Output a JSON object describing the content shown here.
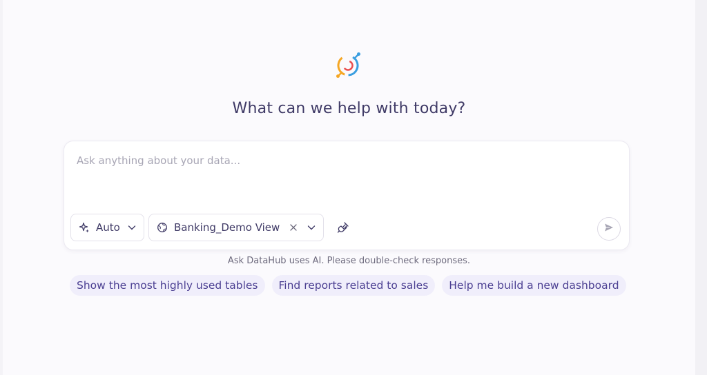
{
  "logo": {
    "icon": "datahub-logo-icon",
    "colors": [
      "#f5a623",
      "#e94f4f",
      "#3a9ee0"
    ]
  },
  "heading": "What can we help with today?",
  "composer": {
    "placeholder": "Ask anything about your data...",
    "value": "",
    "mode": {
      "icon": "sparkle-icon",
      "label": "Auto"
    },
    "view": {
      "icon": "globe-icon",
      "label": "Banking_Demo View"
    },
    "plug_icon": "plug-icon",
    "send_icon": "send-icon"
  },
  "disclaimer": "Ask DataHub uses AI. Please double-check responses.",
  "suggestions": [
    "Show the most highly used tables",
    "Find reports related to sales",
    "Help me build a new dashboard"
  ],
  "colors": {
    "accent": "#4b3f92",
    "heading": "#3f3a66",
    "chip_bg": "#f0eefb"
  }
}
